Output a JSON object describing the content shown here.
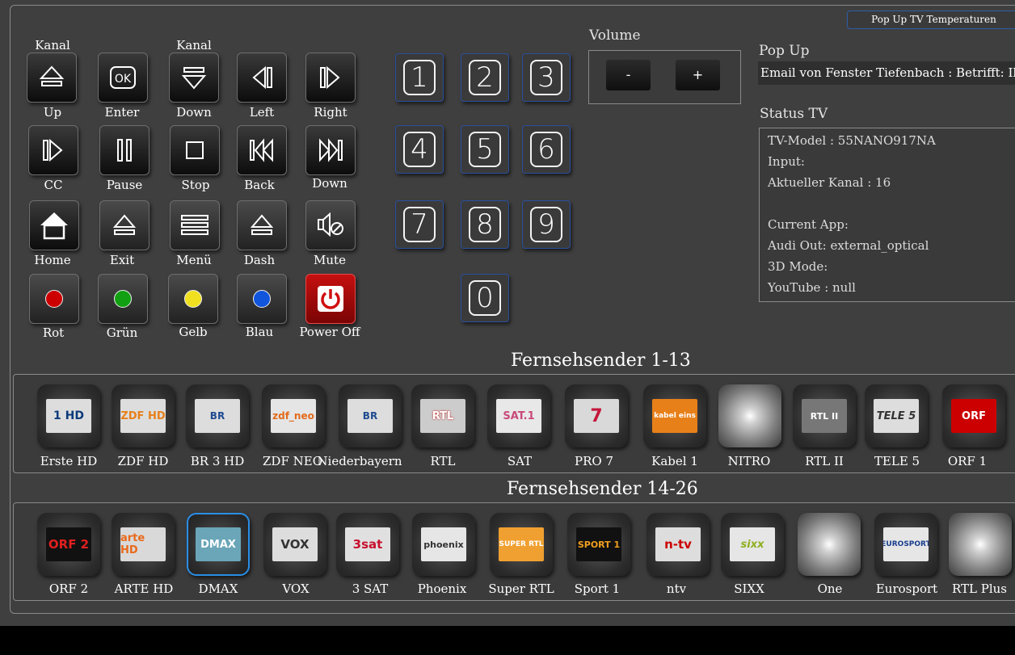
{
  "top_button": "Pop Up TV Temperaturen",
  "remote": {
    "kanal_up": "Kanal",
    "kanal_down": "Kanal",
    "row1": [
      "Up",
      "Enter",
      "Down",
      "Left",
      "Right"
    ],
    "row2": [
      "CC",
      "Pause",
      "Stop",
      "Back",
      "Down"
    ],
    "row3": [
      "Home",
      "Exit",
      "Menü",
      "Dash",
      "Mute"
    ],
    "row4": [
      "Rot",
      "Grün",
      "Gelb",
      "Blau",
      "Power Off"
    ],
    "ok_glyph": "OK",
    "colors": {
      "rot": "#cc0000",
      "gruen": "#11a011",
      "gelb": "#f0e020",
      "blau": "#1155dd",
      "power": "#d01010"
    }
  },
  "numpad": [
    "1",
    "2",
    "3",
    "4",
    "5",
    "6",
    "7",
    "8",
    "9",
    "0"
  ],
  "volume": {
    "title": "Volume",
    "minus": "-",
    "plus": "+"
  },
  "popup": {
    "title": "Pop Up",
    "text": "Email von Fenster Tiefenbach : Betrifft: Ihre neue"
  },
  "status": {
    "title": "Status TV",
    "lines": [
      "TV-Model : 55NANO917NA",
      "Input:",
      "Aktueller Kanal : 16",
      "",
      "Current App:",
      "Audi Out: external_optical",
      "3D Mode:",
      "YouTube : null"
    ]
  },
  "section1": {
    "title": "Fernsehsender 1-13",
    "channels": [
      "Erste HD",
      "ZDF HD",
      "BR 3 HD",
      "ZDF NEO",
      "Niederbayern",
      "RTL",
      "SAT",
      "PRO 7",
      "Kabel 1",
      "NITRO",
      "RTL II",
      "TELE 5",
      "ORF 1"
    ],
    "logos": [
      "1 HD",
      "ZDF HD",
      "BR",
      "zdf_neo",
      "BR",
      "RTL",
      "SAT.1",
      "7",
      "kabel eins",
      "",
      "RTL II",
      "TELE 5",
      "ORF"
    ]
  },
  "section2": {
    "title": "Fernsehsender 14-26",
    "channels": [
      "ORF 2",
      "ARTE HD",
      "DMAX",
      "VOX",
      "3 SAT",
      "Phoenix",
      "Super RTL",
      "Sport 1",
      "ntv",
      "SIXX",
      "One",
      "Eurosport",
      "RTL Plus"
    ],
    "logos": [
      "ORF 2",
      "arte HD",
      "DMAX",
      "VOX",
      "3sat",
      "phoenix",
      "SUPER RTL",
      "SPORT 1",
      "n-tv",
      "sixx",
      "",
      "EUROSPORT",
      ""
    ]
  }
}
